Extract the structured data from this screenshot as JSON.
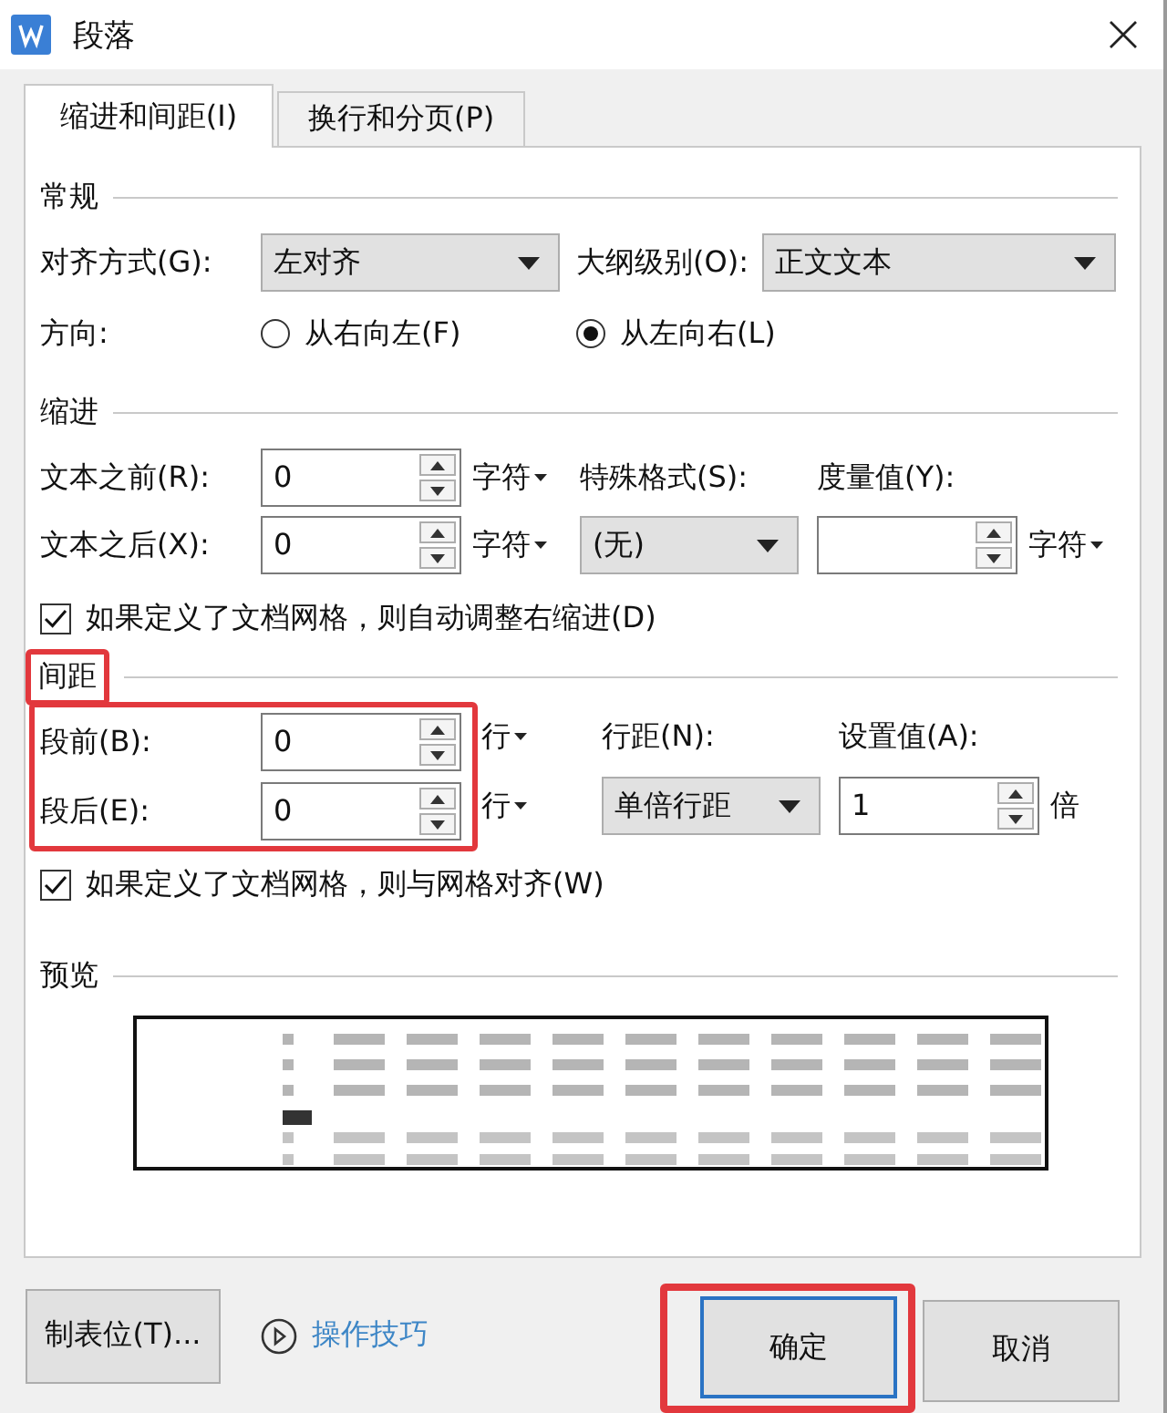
{
  "window": {
    "title": "段落"
  },
  "tabs": [
    {
      "label": "缩进和间距(I)",
      "selected": true
    },
    {
      "label": "换行和分页(P)",
      "selected": false
    }
  ],
  "general": {
    "heading": "常规",
    "alignment": {
      "label": "对齐方式(G):",
      "value": "左对齐"
    },
    "outline_level": {
      "label": "大纲级别(O):",
      "value": "正文文本"
    },
    "direction": {
      "label": "方向:",
      "options": [
        {
          "label": "从右向左(F)",
          "selected": false
        },
        {
          "label": "从左向右(L)",
          "selected": true
        }
      ]
    }
  },
  "indent": {
    "heading": "缩进",
    "before_text": {
      "label": "文本之前(R):",
      "value": "0",
      "unit": "字符",
      "menu": true
    },
    "after_text": {
      "label": "文本之后(X):",
      "value": "0",
      "unit": "字符",
      "menu": true
    },
    "special": {
      "label": "特殊格式(S):",
      "value": "(无)"
    },
    "measure": {
      "label": "度量值(Y):",
      "unit": "字符",
      "menu": true
    },
    "auto_adjust": {
      "label": "如果定义了文档网格，则自动调整右缩进(D)",
      "checked": true
    }
  },
  "spacing": {
    "heading": "间距",
    "heading_highlighted": true,
    "rows_highlighted": true,
    "before": {
      "label": "段前(B):",
      "value": "0",
      "unit": "行",
      "menu": true
    },
    "after": {
      "label": "段后(E):",
      "value": "0",
      "unit": "行",
      "menu": true
    },
    "line_spacing": {
      "label": "行距(N):",
      "value": "单倍行距"
    },
    "set_value": {
      "label": "设置值(A):",
      "value": "1",
      "unit": "倍",
      "menu": false
    },
    "snap_grid": {
      "label": "如果定义了文档网格，则与网格对齐(W)",
      "checked": true
    }
  },
  "preview": {
    "heading": "预览"
  },
  "footer": {
    "tabs_button": "制表位(T)...",
    "tips_link": "操作技巧",
    "ok": {
      "label": "确定",
      "highlighted": true
    },
    "cancel": "取消"
  }
}
